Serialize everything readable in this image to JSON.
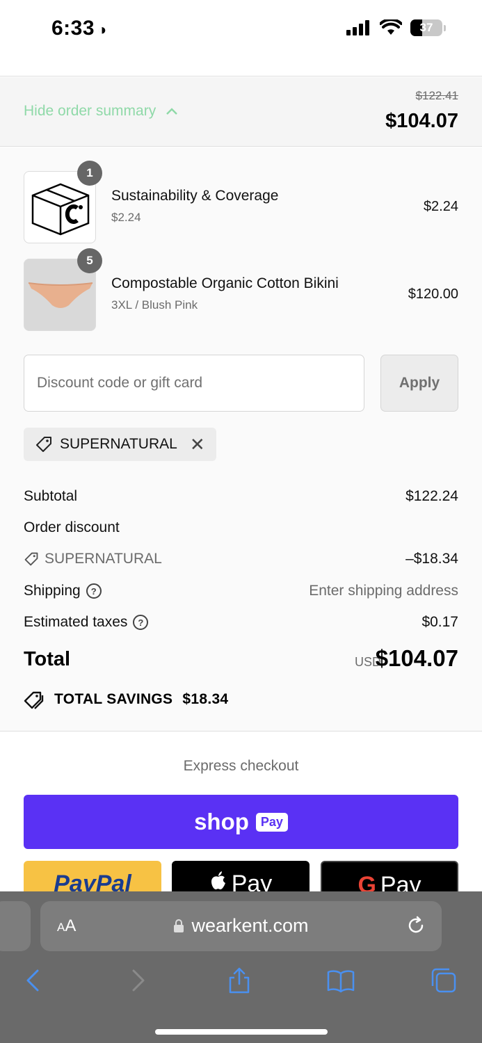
{
  "status": {
    "time": "6:33",
    "battery": "37"
  },
  "summary_toggle": {
    "label": "Hide order summary",
    "compare_price": "$122.41",
    "price": "$104.07"
  },
  "line_items": [
    {
      "name": "Sustainability & Coverage",
      "variant": "$2.24",
      "price": "$2.24",
      "quantity": "1"
    },
    {
      "name": "Compostable Organic Cotton Bikini",
      "variant": "3XL / Blush Pink",
      "price": "$120.00",
      "quantity": "5"
    }
  ],
  "discount": {
    "placeholder": "Discount code or gift card",
    "apply_label": "Apply",
    "applied_code": "SUPERNATURAL"
  },
  "totals": {
    "subtotal_label": "Subtotal",
    "subtotal_value": "$122.24",
    "order_discount_label": "Order discount",
    "discount_code": "SUPERNATURAL",
    "discount_value": "–$18.34",
    "shipping_label": "Shipping",
    "shipping_value": "Enter shipping address",
    "taxes_label": "Estimated taxes",
    "taxes_value": "$0.17",
    "total_label": "Total",
    "currency": "USD",
    "total_value": "$104.07",
    "savings_label": "TOTAL SAVINGS",
    "savings_value": "$18.34"
  },
  "express": {
    "label": "Express checkout",
    "shop_pay_word": "shop",
    "shop_pay_box": "Pay",
    "paypal": "PayPal",
    "apple_pay": "Pay",
    "google_g": "G",
    "google_pay": "Pay"
  },
  "browser": {
    "aa_small": "A",
    "aa_large": "A",
    "url": "wearkent.com"
  },
  "colors": {
    "link_green": "#8fd9a8",
    "shop_pay_purple": "#5a31f4",
    "paypal_yellow": "#f7c244"
  }
}
